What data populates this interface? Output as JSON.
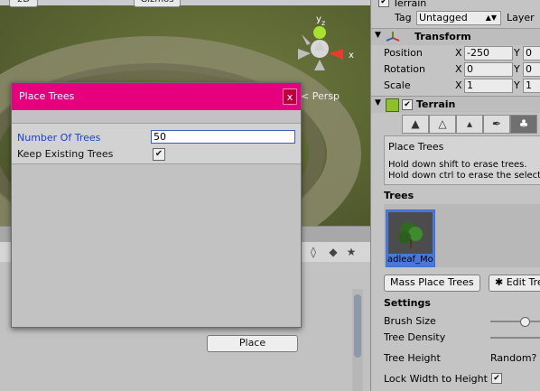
{
  "scene": {
    "toolbar_left_label": "2D",
    "toolbar_mid_label": "Gizmos",
    "persp_label": "< Persp",
    "gizmo_y": "y",
    "gizmo_z": "z",
    "gizmo_x": "x"
  },
  "dialog": {
    "title": "Place Trees",
    "close_label": "x",
    "fields": {
      "number_of_trees_label": "Number Of Trees",
      "number_of_trees_value": "50",
      "keep_existing_label": "Keep Existing Trees",
      "keep_existing_checked": true
    },
    "place_button": "Place"
  },
  "inspector": {
    "object_name": "Terrain",
    "tag_label": "Tag",
    "tag_value": "Untagged",
    "layer_label": "Layer",
    "transform": {
      "title": "Transform",
      "position_label": "Position",
      "rotation_label": "Rotation",
      "scale_label": "Scale",
      "x_label": "X",
      "y_label": "Y",
      "position_x": "-250",
      "position_y": "0",
      "rotation_x": "0",
      "rotation_y": "0",
      "scale_x": "1",
      "scale_y": "1"
    },
    "terrain": {
      "title": "Terrain",
      "tool_title": "Place Trees",
      "hint_1": "Hold down shift to erase trees.",
      "hint_2": "Hold down ctrl to erase the select",
      "trees_header": "Trees",
      "tree_item_label": "adleaf_Mo",
      "mass_place_button": "Mass Place Trees",
      "edit_trees_button": "✱ Edit Tre",
      "settings_header": "Settings",
      "brush_size_label": "Brush Size",
      "tree_density_label": "Tree Density",
      "tree_height_label": "Tree Height",
      "random_label": "Random?",
      "lock_width_label": "Lock Width to Height",
      "lock_width_checked": true
    }
  }
}
